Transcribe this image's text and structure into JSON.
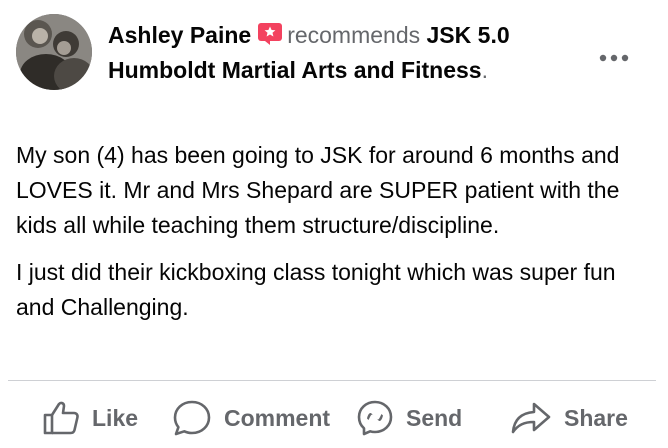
{
  "post": {
    "author": "Ashley Paine",
    "badge_icon": "recommend-badge-icon",
    "recommends_text": "recommends",
    "page_name": "JSK 5.0 Humboldt Martial Arts and Fitness",
    "period": ".",
    "more_icon": "more-options-icon",
    "paragraphs": [
      "My son (4) has been going to JSK for around 6 months and LOVES it. Mr and Mrs Shepard are SUPER patient with the kids all while teaching them structure/discipline.",
      "I just did their kickboxing class tonight which was super fun and Challenging."
    ]
  },
  "actions": {
    "like": "Like",
    "comment": "Comment",
    "send": "Send",
    "share": "Share"
  },
  "colors": {
    "text_primary": "#050505",
    "text_secondary": "#65676b",
    "badge": "#f3425f",
    "divider": "#ced0d4"
  }
}
